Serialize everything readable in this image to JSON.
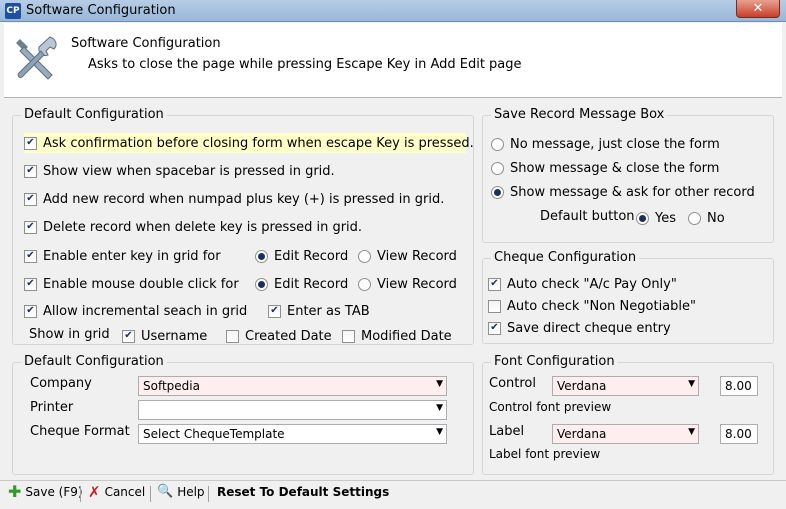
{
  "window": {
    "title": "Software Configuration",
    "close_label": "✕"
  },
  "header": {
    "title": "Software Configuration",
    "subtitle": "Asks to close the page while pressing Escape Key in Add Edit page"
  },
  "default_config": {
    "title": "Default Configuration",
    "opt_escape": "Ask confirmation before closing form when escape Key is pressed.",
    "opt_spacebar": "Show view when spacebar is pressed in grid.",
    "opt_numpad": "Add new record when numpad plus key (+)  is pressed in grid.",
    "opt_delete": "Delete record when delete key is pressed in grid.",
    "opt_enter": "Enable enter key in grid  for",
    "opt_mouse": "Enable mouse double click for",
    "edit_record": "Edit Record",
    "view_record": "View Record",
    "opt_incremental": "Allow incremental seach in grid",
    "opt_enter_tab": "Enter as TAB",
    "show_in_grid": "Show in grid",
    "col_username": "Username",
    "col_created": "Created Date",
    "col_modified": "Modified Date"
  },
  "save_message": {
    "title": "Save Record Message Box",
    "opt_no_message": "No message, just close the form",
    "opt_show_close": "Show message & close the form",
    "opt_show_ask": "Show message & ask for other record",
    "default_button": "Default button",
    "yes": "Yes",
    "no": "No"
  },
  "cheque": {
    "title": "Cheque Configuration",
    "opt_ac_pay": "Auto check \"A/c Pay Only\"",
    "opt_non_neg": "Auto check \"Non Negotiable\"",
    "opt_direct": "Save direct cheque entry"
  },
  "default_config2": {
    "title": "Default Configuration",
    "company_label": "Company",
    "company_value": "Softpedia",
    "printer_label": "Printer",
    "printer_value": "",
    "cheque_format_label": "Cheque Format",
    "cheque_format_value": "Select ChequeTemplate"
  },
  "font_config": {
    "title": "Font Configuration",
    "control_label": "Control",
    "control_font": "Verdana",
    "control_size": "8.00",
    "control_preview": "Control font preview",
    "label_label": "Label",
    "label_font": "Verdana",
    "label_size": "8.00",
    "label_preview": "Label font preview"
  },
  "toolbar": {
    "save": "Save (F9)",
    "cancel": "Cancel",
    "help": "Help",
    "reset": "Reset To Default Settings"
  },
  "colors": {
    "save_icon": "#2e9b2e",
    "cancel_icon": "#c62020",
    "highlight": "#ffffc8"
  }
}
